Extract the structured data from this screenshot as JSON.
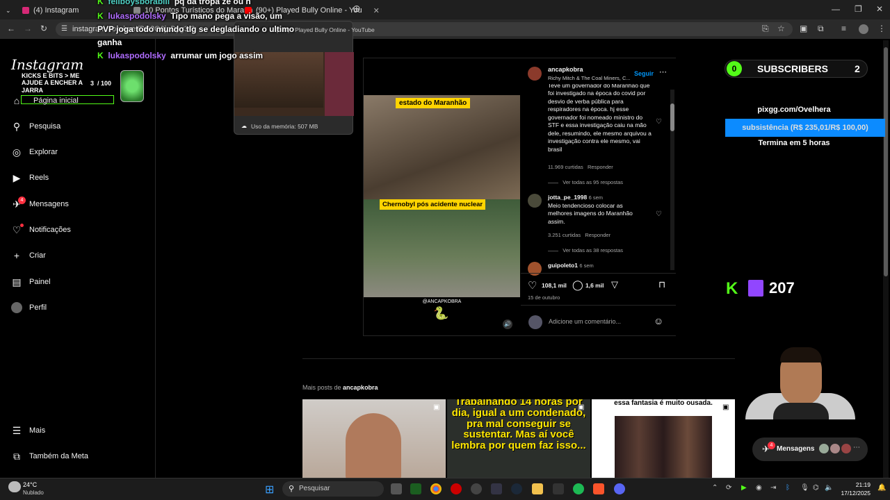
{
  "browser": {
    "tabs": [
      {
        "label": "(4) Instagram"
      },
      {
        "label": "10 Pontos Turísticos do Maranh"
      },
      {
        "label": "(90+) Played Bully Online - You"
      }
    ],
    "url": "instagram.com/reel/DP2G0jpDyg3/?",
    "tooltip_title": "(90+) I Played Bully Online - YouTube",
    "memory": "Uso da memória: 507 MB"
  },
  "sidebar": {
    "logo": "Instagram",
    "items": [
      {
        "label": "Página inicial"
      },
      {
        "label": "Pesquisa"
      },
      {
        "label": "Explorar"
      },
      {
        "label": "Reels"
      },
      {
        "label": "Mensagens",
        "badge": "4"
      },
      {
        "label": "Notificações"
      },
      {
        "label": "Criar"
      },
      {
        "label": "Painel"
      },
      {
        "label": "Perfil"
      }
    ],
    "bottom": [
      {
        "label": "Mais"
      },
      {
        "label": "Também da Meta"
      }
    ]
  },
  "goal": {
    "text": "KICKS E BITS > ME AJUDE A ENCHER A JARRA",
    "count": "3",
    "total": "/ 100"
  },
  "chat": [
    {
      "user": "feliboysborabill",
      "msg": "pq da tropa ze ou n"
    },
    {
      "user": "lukaspodolsky",
      "msg": "Tipo mano pega a visão, um PVP joga todo mundo tlg se degladiando o ultimo ganha"
    },
    {
      "user": "lukaspodolsky",
      "msg": "arrumar um jogo assim"
    }
  ],
  "post": {
    "caption_top": "estado do Maranhão",
    "caption_mid": "Chernobyl pós acidente nuclear",
    "watermark": "@ANCAPKOBRA",
    "author": "ancapkobra",
    "music": "Richy Mitch & The Coal Miners, C...",
    "follow": "Seguir",
    "comments": [
      {
        "user": "",
        "age": "",
        "text": "Teve um governador do Maranhão que foi investigado na época do covid por desvio de verba pública para respiradores na época. hj esse governador foi nomeado ministro do STF e essa investigação caiu na mão dele, resumindo, ele mesmo arquivou a investigação contra ele mesmo, vai brasil",
        "likes": "11.969 curtidas",
        "reply": "Responder",
        "replies": "Ver todas as 95 respostas"
      },
      {
        "user": "jotta_pe_1998",
        "age": "6 sem",
        "text": "Meio tendencioso colocar as melhores imagens do Maranhão assim.",
        "likes": "3.251 curtidas",
        "reply": "Responder",
        "replies": "Ver todas as 38 respostas"
      },
      {
        "user": "guipoleto1",
        "age": "6 sem",
        "text": "",
        "likes": "",
        "reply": "",
        "replies": ""
      }
    ],
    "likes": "108,1 mil",
    "comment_count": "1,6 mil",
    "date": "15 de outubro",
    "add_comment": "Adicione um comentário..."
  },
  "more_posts": {
    "label": "Mais posts de",
    "author": "ancapkobra",
    "thumbs": [
      {
        "text": ""
      },
      {
        "text": "Trabalhando 14 horas por dia, igual a um condenado, pra mal conseguir se sustentar. Mas aí você lembra por quem faz isso..."
      },
      {
        "text": "essa fantasia é muito ousada."
      }
    ]
  },
  "stream": {
    "subs_left": "0",
    "subs_label": "SUBSCRIBERS",
    "subs_right": "2",
    "pix": "pixgg.com/Ovelhera",
    "goal_bar": "subsistência (R$ 235,01/R$ 100,00)",
    "ends": "Termina em 5 horas",
    "kick_count": "207"
  },
  "messages_pill": {
    "label": "Mensagens",
    "badge": "4"
  },
  "taskbar": {
    "temp": "24°C",
    "weather": "Nublado",
    "search": "Pesquisar",
    "time": "21:19",
    "date": "17/12/2025"
  },
  "colors": {
    "kick": "#53fc18",
    "follow": "#0095f6",
    "goal_bar": "#0c8bff"
  }
}
